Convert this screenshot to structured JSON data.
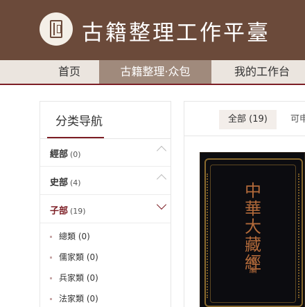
{
  "header": {
    "site_title": "古籍整理工作平臺",
    "logo_icon": "book-icon"
  },
  "nav": {
    "items": [
      {
        "label": "首页"
      },
      {
        "label": "古籍整理·众包",
        "active": true
      },
      {
        "label": "我的工作台"
      }
    ]
  },
  "sidebar": {
    "title": "分类导航",
    "categories": [
      {
        "label": "經部",
        "count": "(0)",
        "expanded": false
      },
      {
        "label": "史部",
        "count": "(4)",
        "expanded": false
      },
      {
        "label": "子部",
        "count": "(19)",
        "expanded": true
      }
    ],
    "subitems": [
      {
        "label": "總類",
        "count": "(0)"
      },
      {
        "label": "儒家類",
        "count": "(0)"
      },
      {
        "label": "兵家類",
        "count": "(0)"
      },
      {
        "label": "法家類",
        "count": "(0)"
      }
    ]
  },
  "content": {
    "tabs": [
      {
        "label": "全部 (19)",
        "active": true
      },
      {
        "label": "可申"
      }
    ],
    "book": {
      "title": "中華大藏經",
      "subtitle": "續編"
    }
  },
  "colors": {
    "header_bg": "#6b4a3a",
    "accent": "#7c1d24",
    "nav_active": "#a08a7c"
  }
}
